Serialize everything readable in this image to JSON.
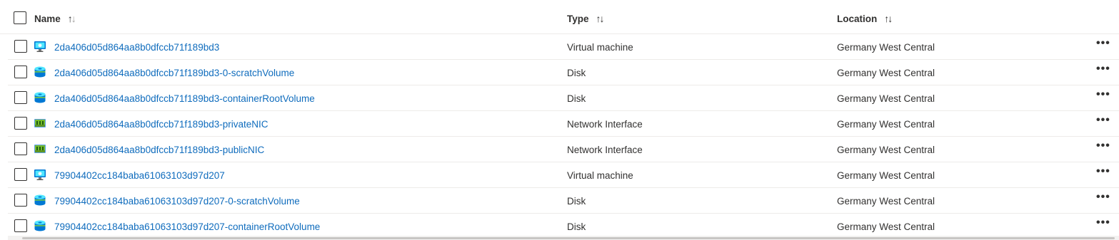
{
  "header": {
    "name_label": "Name",
    "type_label": "Type",
    "location_label": "Location",
    "sort_glyph_up": "↑",
    "sort_glyph_down": "↓"
  },
  "rows": [
    {
      "name": "2da406d05d864aa8b0dfccb71f189bd3",
      "type": "Virtual machine",
      "location": "Germany West Central",
      "icon": "virtual-machine-icon"
    },
    {
      "name": "2da406d05d864aa8b0dfccb71f189bd3-0-scratchVolume",
      "type": "Disk",
      "location": "Germany West Central",
      "icon": "disk-icon"
    },
    {
      "name": "2da406d05d864aa8b0dfccb71f189bd3-containerRootVolume",
      "type": "Disk",
      "location": "Germany West Central",
      "icon": "disk-icon"
    },
    {
      "name": "2da406d05d864aa8b0dfccb71f189bd3-privateNIC",
      "type": "Network Interface",
      "location": "Germany West Central",
      "icon": "network-interface-icon"
    },
    {
      "name": "2da406d05d864aa8b0dfccb71f189bd3-publicNIC",
      "type": "Network Interface",
      "location": "Germany West Central",
      "icon": "network-interface-icon"
    },
    {
      "name": "79904402cc184baba61063103d97d207",
      "type": "Virtual machine",
      "location": "Germany West Central",
      "icon": "virtual-machine-icon"
    },
    {
      "name": "79904402cc184baba61063103d97d207-0-scratchVolume",
      "type": "Disk",
      "location": "Germany West Central",
      "icon": "disk-icon"
    },
    {
      "name": "79904402cc184baba61063103d97d207-containerRootVolume",
      "type": "Disk",
      "location": "Germany West Central",
      "icon": "disk-icon"
    }
  ],
  "more_label": "•••",
  "colors": {
    "link": "#0f6cbd",
    "text": "#323130",
    "border": "#edebe9"
  }
}
